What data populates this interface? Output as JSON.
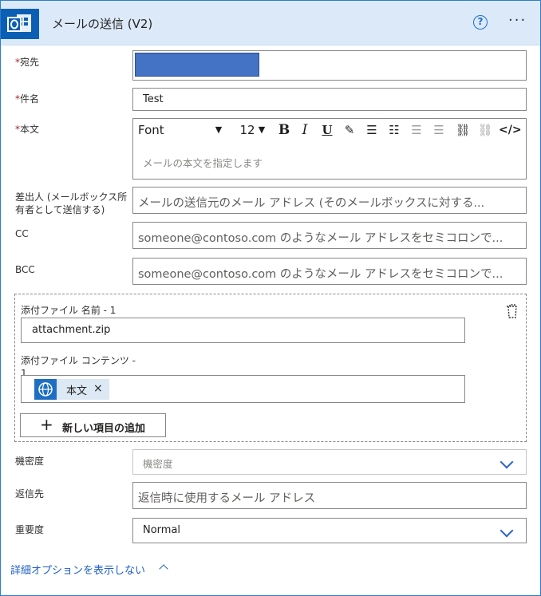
{
  "header": {
    "title": "メールの送信 (V2)",
    "help_glyph": "?",
    "more_glyph": "···",
    "app_icon": "outlook-icon",
    "accent_color": "#0a5fb4"
  },
  "fields": {
    "to": {
      "required": "*",
      "label": "宛先"
    },
    "subject": {
      "required": "*",
      "label": "件名",
      "value": "Test"
    },
    "body": {
      "required": "*",
      "label": "本文",
      "font": "Font",
      "font_size": "12",
      "placeholder": "メールの本文を指定します"
    },
    "from": {
      "label": "差出人 (メールボックス所有者として送信する)",
      "placeholder": "メールの送信元のメール アドレス (そのメールボックスに対する..."
    },
    "cc": {
      "label": "CC",
      "placeholder": "someone@contoso.com のようなメール アドレスをセミコロンで..."
    },
    "bcc": {
      "label": "BCC",
      "placeholder": "someone@contoso.com のようなメール アドレスをセミコロンで..."
    }
  },
  "attachment": {
    "name_label": "添付ファイル 名前 - 1",
    "name_value": "attachment.zip",
    "content_label": "添付ファイル コンテンツ - 1",
    "token_label": "本文",
    "token_remove": "×",
    "add_button": "新しい項目の追加",
    "add_glyph": "+"
  },
  "sensitivity": {
    "label": "機密度",
    "placeholder": "機密度"
  },
  "reply_to": {
    "label": "返信先",
    "placeholder": "返信時に使用するメール アドレス"
  },
  "importance": {
    "label": "重要度",
    "value": "Normal"
  },
  "advanced_link": "詳細オプションを表示しない"
}
